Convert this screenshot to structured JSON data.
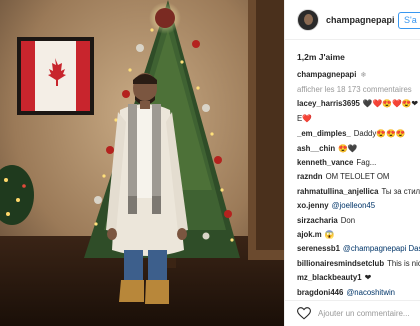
{
  "post": {
    "username": "champagnepapi",
    "follow_label": "S'a",
    "likes": "1,2m J'aime",
    "caption_user": "champagnepapi",
    "caption_text": "❄",
    "view_all": "afficher les 18 173 commentaires",
    "comments": [
      {
        "user": "lacey_harris3695",
        "text": "🖤❤️😍❤️😍❤"
      },
      {
        "user": "",
        "text": "E❤️"
      },
      {
        "user": "_em_dimples_",
        "text": "Daddy😍😍😍"
      },
      {
        "user": "ash__chin",
        "text": "😍🖤"
      },
      {
        "user": "kenneth_vance",
        "text": "Fag..."
      },
      {
        "user": "razndn",
        "text": "OM TELOLET OM"
      },
      {
        "user": "rahmatullina_anjellica",
        "text": "Ты за стил"
      },
      {
        "user": "xo.jenny",
        "text": "@joelleon45"
      },
      {
        "user": "sirzacharia",
        "text": "Don"
      },
      {
        "user": "ajok.m",
        "text": "😱"
      },
      {
        "user": "serenessb1",
        "text": "@champagnepapi Das"
      },
      {
        "user": "billionairesmindsetclub",
        "text": "This is nic"
      },
      {
        "user": "mz_blackbeauty1",
        "text": "❤"
      },
      {
        "user": "bragdoni446",
        "text": "@nacoshitwin"
      }
    ],
    "add_comment_placeholder": "Ajouter un commentaire..."
  },
  "icons": {
    "heart": "heart-icon",
    "flag": "canada-flag"
  }
}
